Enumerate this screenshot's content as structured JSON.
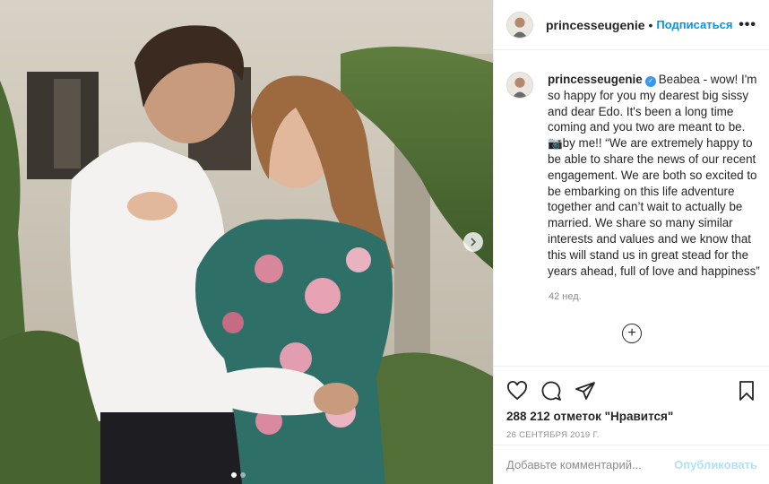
{
  "post": {
    "username": "princesseugenie",
    "header_separator": "•",
    "follow_label": "Подписаться",
    "more_label": "•••",
    "caption_username": "princesseugenie",
    "caption_text": "Beabea - wow! I'm so happy for you my dearest big sissy and dear Edo. It's been a long time coming and you two are meant to be. 📷by me!! “We are extremely happy to be able to share the news of our recent engagement. We are both so excited to be embarking on this life adventure together and can’t wait to actually be married. We share so many similar interests and values and we know that this will stand us in great stead for the years ahead, full of love and happiness”",
    "time_ago": "42 нед.",
    "load_more_label": "+",
    "likes": "288 212 отметок \"Нравится\"",
    "date": "26 СЕНТЯБРЯ 2019 Г.",
    "comment_placeholder": "Добавьте комментарий...",
    "post_label": "Опубликовать"
  },
  "icons": {
    "verified": "verified-badge-icon",
    "like": "heart-icon",
    "comment": "comment-bubble-icon",
    "share": "paper-plane-icon",
    "save": "bookmark-icon",
    "next": "chevron-right-icon"
  },
  "carousel": {
    "current": 1,
    "total": 2
  },
  "colors": {
    "accent": "#0095f6",
    "verified": "#3897f0",
    "muted": "#8e8e8e",
    "post_disabled": "#b2dffc"
  }
}
